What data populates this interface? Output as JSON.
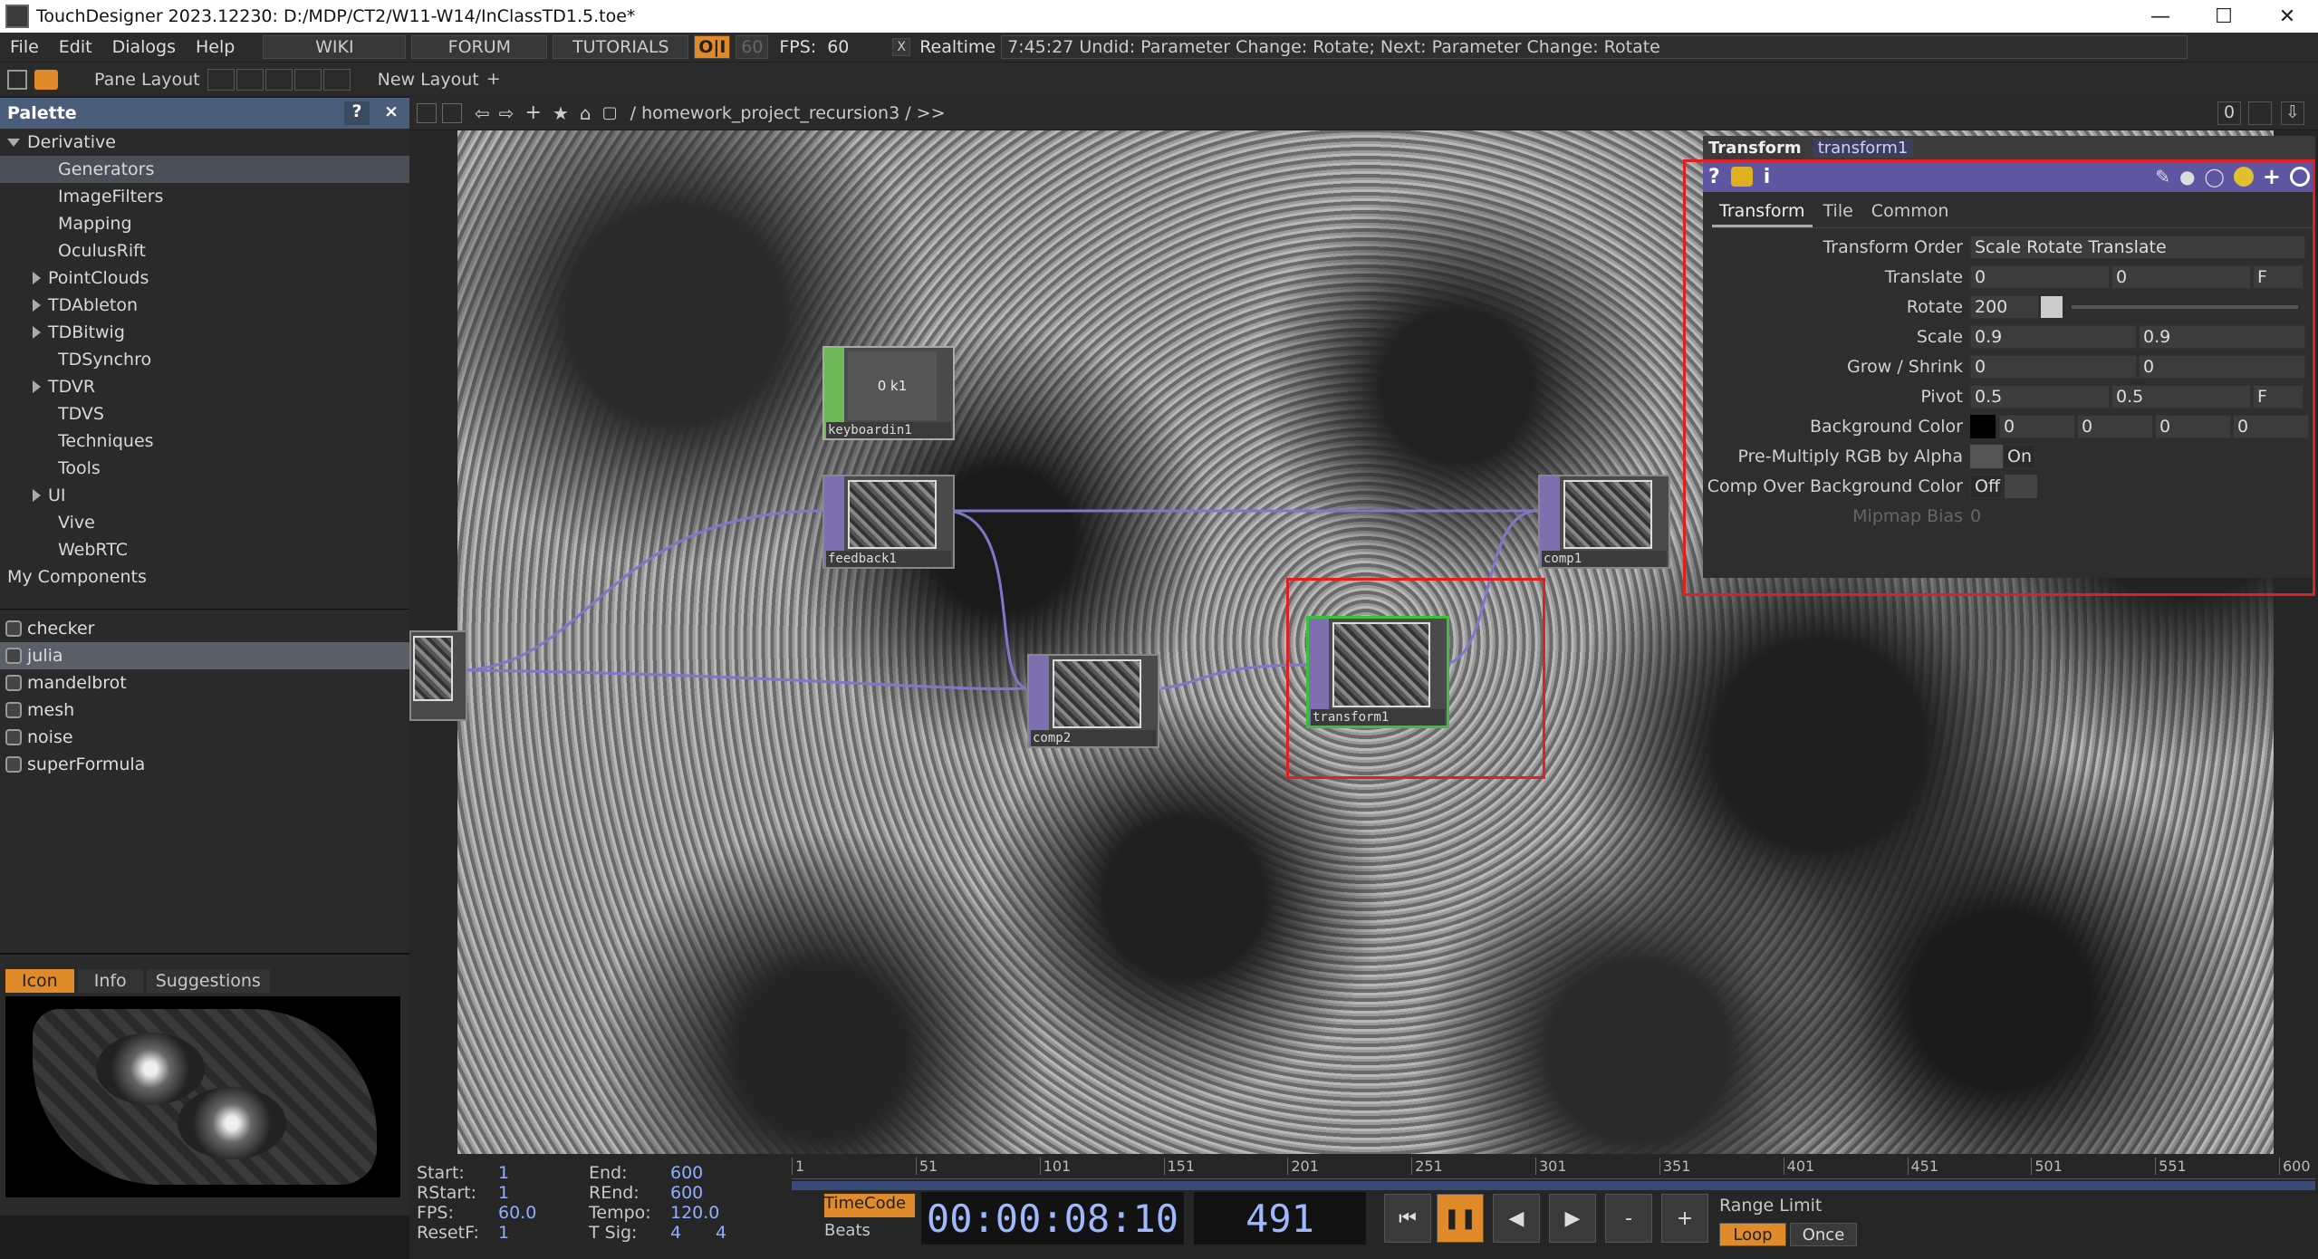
{
  "window": {
    "title": "TouchDesigner 2023.12230: D:/MDP/CT2/W11-W14/InClassTD1.5.toe*"
  },
  "menu": {
    "items": [
      "File",
      "Edit",
      "Dialogs",
      "Help"
    ],
    "buttons": [
      "WIKI",
      "FORUM",
      "TUTORIALS"
    ],
    "oi": "O|I",
    "fps_val_dim": "60",
    "fps_label": "FPS:",
    "fps_value": "60",
    "realtime_box": "X",
    "realtime": "Realtime",
    "status": "7:45:27 Undid: Parameter Change: Rotate; Next: Parameter Change: Rotate"
  },
  "toolbar2": {
    "pane_layout": "Pane Layout",
    "new_layout": "New Layout",
    "plus": "+"
  },
  "palette": {
    "title": "Palette",
    "help": "?",
    "close": "×",
    "tree": [
      {
        "label": "Derivative",
        "indent": 0,
        "arrow": "down"
      },
      {
        "label": "Generators",
        "indent": 2,
        "arrow": "none",
        "selected": true
      },
      {
        "label": "ImageFilters",
        "indent": 2,
        "arrow": "none"
      },
      {
        "label": "Mapping",
        "indent": 2,
        "arrow": "none"
      },
      {
        "label": "OculusRift",
        "indent": 2,
        "arrow": "none"
      },
      {
        "label": "PointClouds",
        "indent": 1,
        "arrow": "right"
      },
      {
        "label": "TDAbleton",
        "indent": 1,
        "arrow": "right"
      },
      {
        "label": "TDBitwig",
        "indent": 1,
        "arrow": "right"
      },
      {
        "label": "TDSynchro",
        "indent": 2,
        "arrow": "none"
      },
      {
        "label": "TDVR",
        "indent": 1,
        "arrow": "right"
      },
      {
        "label": "TDVS",
        "indent": 2,
        "arrow": "none"
      },
      {
        "label": "Techniques",
        "indent": 2,
        "arrow": "none"
      },
      {
        "label": "Tools",
        "indent": 2,
        "arrow": "none"
      },
      {
        "label": "UI",
        "indent": 1,
        "arrow": "right"
      },
      {
        "label": "Vive",
        "indent": 2,
        "arrow": "none"
      },
      {
        "label": "WebRTC",
        "indent": 2,
        "arrow": "none"
      },
      {
        "label": "My Components",
        "indent": 0,
        "arrow": "none"
      }
    ],
    "components": [
      {
        "label": "checker"
      },
      {
        "label": "julia",
        "selected": true
      },
      {
        "label": "mandelbrot"
      },
      {
        "label": "mesh"
      },
      {
        "label": "noise"
      },
      {
        "label": "superFormula"
      }
    ],
    "tabs": [
      "Icon",
      "Info",
      "Suggestions"
    ]
  },
  "network": {
    "path": "/ homework_project_recursion3 / >>",
    "zero": "0",
    "nodes": [
      {
        "label": "keyboardin1",
        "thumb_text": "0 k1"
      },
      {
        "label": "feedback1"
      },
      {
        "label": "comp2"
      },
      {
        "label": "transform1"
      },
      {
        "label": "comp1"
      }
    ]
  },
  "params": {
    "type": "Transform",
    "name": "transform1",
    "tabs": [
      "Transform",
      "Tile",
      "Common"
    ],
    "transform_order_label": "Transform Order",
    "transform_order": "Scale Rotate Translate",
    "translate_label": "Translate",
    "translate": [
      "0",
      "0"
    ],
    "translate_unit": "F",
    "rotate_label": "Rotate",
    "rotate": "200",
    "scale_label": "Scale",
    "scale": [
      "0.9",
      "0.9"
    ],
    "grow_label": "Grow / Shrink",
    "grow": [
      "0",
      "0"
    ],
    "pivot_label": "Pivot",
    "pivot": [
      "0.5",
      "0.5"
    ],
    "pivot_unit": "F",
    "bg_label": "Background Color",
    "bg": [
      "0",
      "0",
      "0",
      "0"
    ],
    "premult_label": "Pre-Multiply RGB by Alpha",
    "premult": "On",
    "compover_label": "Comp Over Background Color",
    "compover": "Off",
    "mipmap_label": "Mipmap Bias",
    "mipmap": "0"
  },
  "timeline": {
    "start_l": "Start:",
    "start": "1",
    "end_l": "End:",
    "end": "600",
    "rstart_l": "RStart:",
    "rstart": "1",
    "rend_l": "REnd:",
    "rend": "600",
    "fps_l": "FPS:",
    "fps": "60.0",
    "tempo_l": "Tempo:",
    "tempo": "120.0",
    "resetf_l": "ResetF:",
    "resetf": "1",
    "tsig_l": "T Sig:",
    "tsig": [
      "4",
      "4"
    ],
    "ruler": [
      "1",
      "51",
      "101",
      "151",
      "201",
      "251",
      "301",
      "351",
      "401",
      "451",
      "501",
      "551",
      "600"
    ],
    "timecode_btn": "TimeCode",
    "beats_btn": "Beats",
    "timecode": "00:00:08:10",
    "frame": "491",
    "range_label": "Range Limit",
    "loop": "Loop",
    "once": "Once",
    "minus": "-",
    "plus": "+"
  }
}
